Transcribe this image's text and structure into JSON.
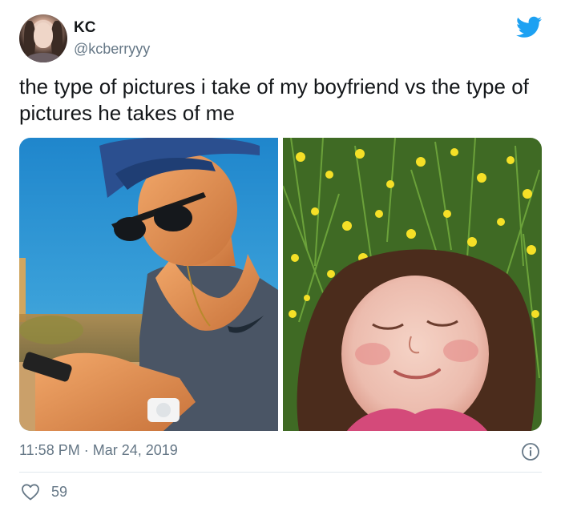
{
  "tweet": {
    "author": {
      "display_name": "KC",
      "handle": "@kcberryyy",
      "avatar_icon": "profile-photo"
    },
    "brand_icon": "twitter-bird-icon",
    "brand_color": "#1da1f2",
    "text": "the type of pictures i take of my boyfriend vs the type of pictures he takes of me",
    "media": [
      {
        "icon": "photo-boy-sunglasses-cap"
      },
      {
        "icon": "photo-girl-lying-in-flowers"
      }
    ],
    "timestamp": "11:58 PM · Mar 24, 2019",
    "likes": "59",
    "info_icon": "info-icon",
    "like_icon": "heart-icon"
  }
}
